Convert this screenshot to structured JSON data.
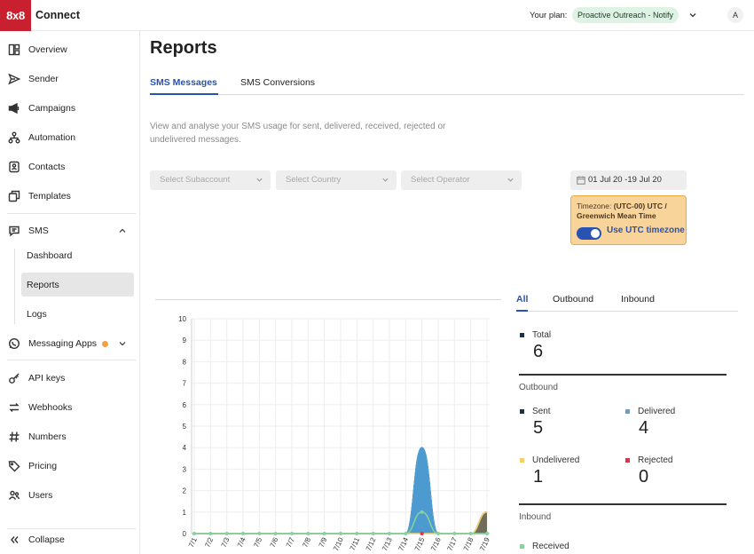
{
  "header": {
    "logo_text": "8x8",
    "app_name": "Connect",
    "plan_label": "Your plan:",
    "plan_value": "Proactive Outreach - Notify",
    "avatar_initial": "A"
  },
  "sidebar": {
    "items": [
      {
        "label": "Overview",
        "icon": "overview-icon"
      },
      {
        "label": "Sender",
        "icon": "send-icon"
      },
      {
        "label": "Campaigns",
        "icon": "megaphone-icon"
      },
      {
        "label": "Automation",
        "icon": "automation-icon"
      },
      {
        "label": "Contacts",
        "icon": "contacts-icon"
      },
      {
        "label": "Templates",
        "icon": "templates-icon"
      }
    ],
    "sms": {
      "label": "SMS",
      "subitems": [
        "Dashboard",
        "Reports",
        "Logs"
      ],
      "active": "Reports"
    },
    "messaging_apps": "Messaging Apps",
    "items2": [
      {
        "label": "API keys",
        "icon": "key-icon"
      },
      {
        "label": "Webhooks",
        "icon": "webhooks-icon"
      },
      {
        "label": "Numbers",
        "icon": "hash-icon"
      },
      {
        "label": "Pricing",
        "icon": "tag-icon"
      },
      {
        "label": "Users",
        "icon": "users-icon"
      }
    ],
    "collapse": "Collapse"
  },
  "main": {
    "title": "Reports",
    "tabs": [
      "SMS Messages",
      "SMS Conversions"
    ],
    "description": "View and analyse your SMS usage for sent, delivered, received, rejected or undelivered messages.",
    "filters": {
      "subaccount": "Select Subaccount",
      "country": "Select Country",
      "operator": "Select Operator"
    },
    "date_range": "01 Jul 20 -19 Jul 20",
    "timezone": {
      "prefix": "Timezone:",
      "value": "(UTC-00) UTC / Greenwich Mean Time",
      "toggle_label": "Use UTC timezone",
      "toggle_on": true
    }
  },
  "stats": {
    "tabs": [
      "All",
      "Outbound",
      "Inbound"
    ],
    "total_label": "Total",
    "total": "6",
    "outbound_label": "Outbound",
    "sent_label": "Sent",
    "sent": "5",
    "delivered_label": "Delivered",
    "delivered": "4",
    "undelivered_label": "Undelivered",
    "undelivered": "1",
    "rejected_label": "Rejected",
    "rejected": "0",
    "inbound_label": "Inbound",
    "received_label": "Received",
    "colors": {
      "total": "#1d2f4a",
      "sent": "#1d2f4a",
      "delivered": "#5aa3d8",
      "undelivered": "#f5cf6a",
      "rejected": "#d9384b",
      "received": "#86d39b"
    }
  },
  "chart_data": {
    "type": "area",
    "categories": [
      "7/1",
      "7/2",
      "7/3",
      "7/4",
      "7/5",
      "7/6",
      "7/7",
      "7/8",
      "7/9",
      "7/10",
      "7/11",
      "7/12",
      "7/13",
      "7/14",
      "7/15",
      "7/16",
      "7/17",
      "7/18",
      "7/19"
    ],
    "ylim": [
      0,
      10
    ],
    "yticks": [
      "0",
      "1",
      "2",
      "3",
      "4",
      "5",
      "6",
      "7",
      "8",
      "9",
      "10"
    ],
    "series": [
      {
        "name": "Delivered",
        "color": "#4e9fd6",
        "values": [
          0,
          0,
          0,
          0,
          0,
          0,
          0,
          0,
          0,
          0,
          0,
          0,
          0,
          0,
          4,
          0,
          0,
          0,
          0
        ]
      },
      {
        "name": "Sent",
        "color": "#1d2f4a",
        "values": [
          0,
          0,
          0,
          0,
          0,
          0,
          0,
          0,
          0,
          0,
          0,
          0,
          0,
          0,
          4,
          0,
          0,
          0,
          1
        ]
      },
      {
        "name": "Undelivered",
        "color": "#f5cf6a",
        "values": [
          0,
          0,
          0,
          0,
          0,
          0,
          0,
          0,
          0,
          0,
          0,
          0,
          0,
          0,
          0,
          0,
          0,
          0,
          1
        ]
      },
      {
        "name": "Received",
        "color": "#86d39b",
        "values": [
          0,
          0,
          0,
          0,
          0,
          0,
          0,
          0,
          0,
          0,
          0,
          0,
          0,
          0,
          1,
          0,
          0,
          0,
          0
        ]
      },
      {
        "name": "Rejected",
        "color": "#d9384b",
        "values": [
          0,
          0,
          0,
          0,
          0,
          0,
          0,
          0,
          0,
          0,
          0,
          0,
          0,
          0,
          0,
          0,
          0,
          0,
          0
        ]
      }
    ],
    "grid": true
  }
}
